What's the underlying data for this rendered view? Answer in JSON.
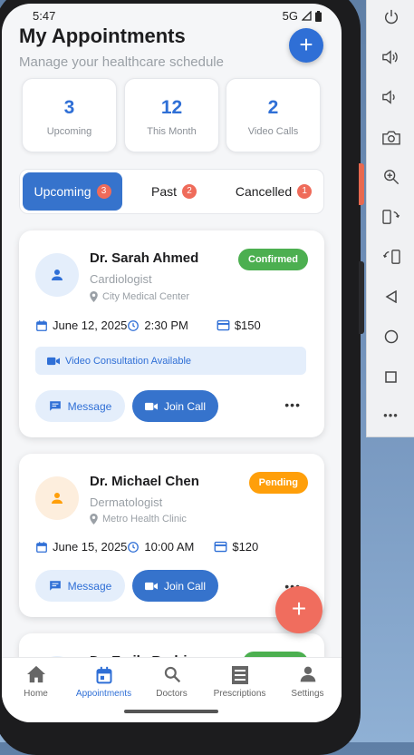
{
  "status": {
    "time": "5:47",
    "network": "5G"
  },
  "header": {
    "title": "My Appointments",
    "subtitle": "Manage your healthcare schedule"
  },
  "stats": [
    {
      "value": "3",
      "label": "Upcoming"
    },
    {
      "value": "12",
      "label": "This Month"
    },
    {
      "value": "2",
      "label": "Video Calls"
    }
  ],
  "tabs": [
    {
      "label": "Upcoming",
      "count": "3"
    },
    {
      "label": "Past",
      "count": "2"
    },
    {
      "label": "Cancelled",
      "count": "1"
    }
  ],
  "appointments": [
    {
      "doctor": "Dr. Sarah Ahmed",
      "specialty": "Cardiologist",
      "location": "City Medical Center",
      "status": "Confirmed",
      "status_color": "#4caf50",
      "date": "June 12, 2025",
      "time": "2:30 PM",
      "fee": "$150",
      "video_note": "Video Consultation Available",
      "message_label": "Message",
      "join_label": "Join Call"
    },
    {
      "doctor": "Dr. Michael Chen",
      "specialty": "Dermatologist",
      "location": "Metro Health Clinic",
      "status": "Pending",
      "status_color": "#ff9f0a",
      "date": "June 15, 2025",
      "time": "10:00 AM",
      "fee": "$120",
      "message_label": "Message",
      "join_label": "Join Call"
    },
    {
      "doctor": "Dr. Emily Rodriguez"
    }
  ],
  "more_label": "•••",
  "fab_label": "+",
  "nav": [
    {
      "label": "Home",
      "icon": "home-icon"
    },
    {
      "label": "Appointments",
      "icon": "calendar-icon"
    },
    {
      "label": "Doctors",
      "icon": "search-icon"
    },
    {
      "label": "Prescriptions",
      "icon": "receipt-icon"
    },
    {
      "label": "Settings",
      "icon": "person-icon"
    }
  ],
  "toolbar_more_label": "•••",
  "colors": {
    "accent": "#3673cc",
    "badge": "#ef6b5a",
    "fab": "#f06d5e"
  }
}
